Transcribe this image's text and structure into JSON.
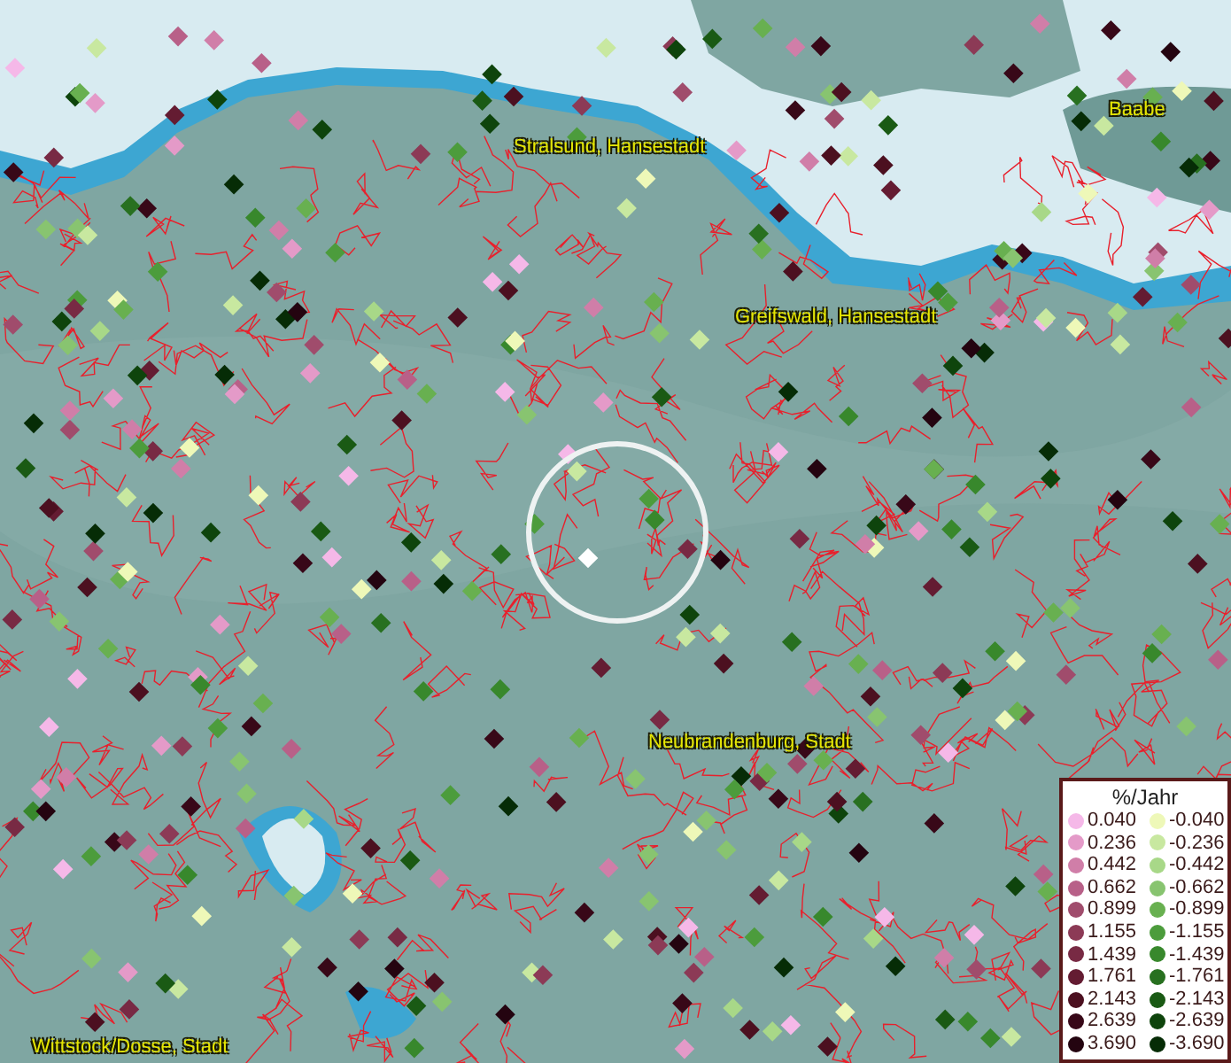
{
  "map": {
    "places": [
      {
        "name": "Baabe"
      },
      {
        "name": "Stralsund, Hansestadt"
      },
      {
        "name": "Greifswald, Hansestadt"
      },
      {
        "name": "Neubrandenburg, Stadt"
      },
      {
        "name": "Wittstock/Dosse, Stadt"
      }
    ]
  },
  "legend": {
    "title": "%/Jahr",
    "rows": [
      {
        "positive": {
          "value": "0.040",
          "color": "#f5b8e8"
        },
        "negative": {
          "value": "-0.040",
          "color": "#eef8b8"
        }
      },
      {
        "positive": {
          "value": "0.236",
          "color": "#e49ac8"
        },
        "negative": {
          "value": "-0.236",
          "color": "#c8e8a0"
        }
      },
      {
        "positive": {
          "value": "0.442",
          "color": "#d07ea8"
        },
        "negative": {
          "value": "-0.442",
          "color": "#a8d888"
        }
      },
      {
        "positive": {
          "value": "0.662",
          "color": "#b86088"
        },
        "negative": {
          "value": "-0.662",
          "color": "#88c470"
        }
      },
      {
        "positive": {
          "value": "0.899",
          "color": "#a04c6c"
        },
        "negative": {
          "value": "-0.899",
          "color": "#68b050"
        }
      },
      {
        "positive": {
          "value": "1.155",
          "color": "#8c3a56"
        },
        "negative": {
          "value": "-1.155",
          "color": "#4c9c3c"
        }
      },
      {
        "positive": {
          "value": "1.439",
          "color": "#782a44"
        },
        "negative": {
          "value": "-1.439",
          "color": "#38882c"
        }
      },
      {
        "positive": {
          "value": "1.761",
          "color": "#641c32"
        },
        "negative": {
          "value": "-1.761",
          "color": "#287020"
        }
      },
      {
        "positive": {
          "value": "2.143",
          "color": "#4c1020"
        },
        "negative": {
          "value": "-2.143",
          "color": "#1a5a14"
        }
      },
      {
        "positive": {
          "value": "2.639",
          "color": "#380818"
        },
        "negative": {
          "value": "-2.639",
          "color": "#0e440c"
        }
      },
      {
        "positive": {
          "value": "3.690",
          "color": "#240410"
        },
        "negative": {
          "value": "-3.690",
          "color": "#062c06"
        }
      }
    ]
  }
}
